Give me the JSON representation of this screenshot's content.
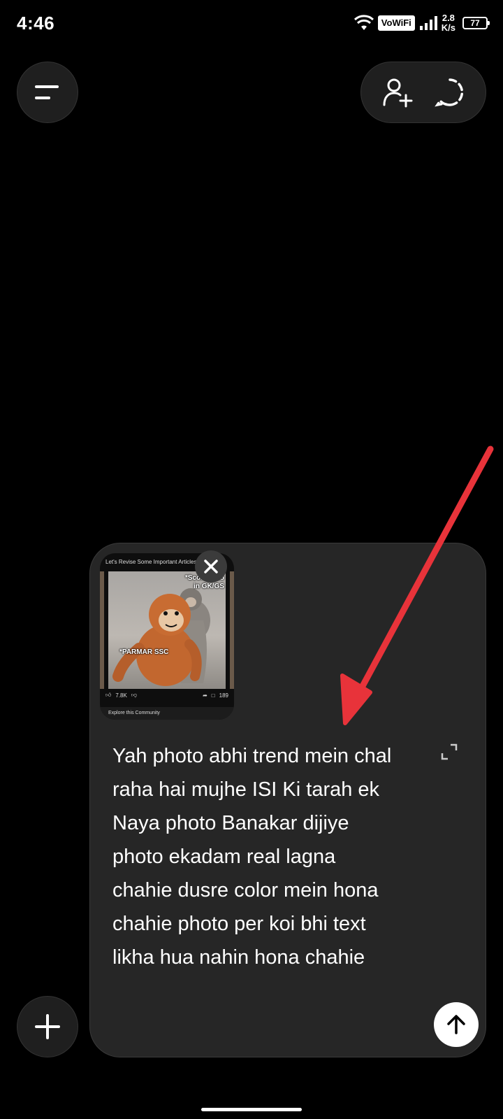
{
  "status_bar": {
    "time": "4:46",
    "vowifi": "VoWiFi",
    "speed_value": "2.8",
    "speed_unit": "K/s",
    "battery": "77"
  },
  "top_bar": {
    "menu_icon": "menu-icon",
    "add_person_icon": "add-person-icon",
    "temporary_chat_icon": "dashed-chat-icon"
  },
  "attachment": {
    "header": "Let's Revise Some Important Articles",
    "caption_top": "*Scoring Lo\nin GK/GS",
    "caption_bottom": "*PARMAR SSC",
    "likes": "7.8K",
    "comments": "189",
    "footer": "Explore this Community",
    "close_icon": "close-icon"
  },
  "composer": {
    "message": "Yah photo abhi trend mein chal raha hai mujhe ISI Ki tarah ek Naya photo Banakar dijiye photo ekadam real lagna chahie dusre color mein hona chahie photo per koi bhi text likha hua nahin hona chahie",
    "expand_icon": "expand-icon",
    "send_icon": "arrow-up-icon"
  },
  "add_button_icon": "plus-icon",
  "colors": {
    "background": "#000000",
    "surface": "#262626",
    "button": "#1f1f1f",
    "annotation_arrow": "#e8333a"
  }
}
